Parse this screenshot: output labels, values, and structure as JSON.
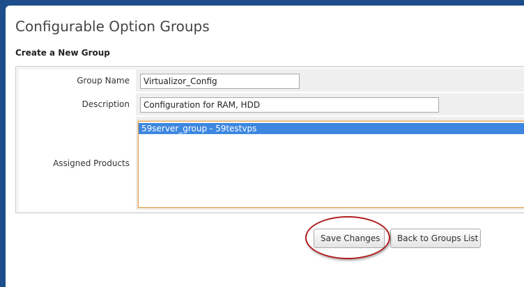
{
  "page": {
    "title": "Configurable Option Groups",
    "section_title": "Create a New Group"
  },
  "form": {
    "group_name": {
      "label": "Group Name",
      "value": "Virtualizor_Config"
    },
    "description": {
      "label": "Description",
      "value": "Configuration for RAM, HDD"
    },
    "assigned_products": {
      "label": "Assigned Products",
      "options": [
        "59server_group - 59testvps"
      ],
      "selected": "59server_group - 59testvps"
    }
  },
  "buttons": {
    "save_label": "Save Changes",
    "back_label": "Back to Groups List"
  },
  "colors": {
    "header_bg": "#1d4d8a",
    "selection": "#3d87e0",
    "highlight_annotation": "#b01c1c",
    "focus_border": "#e0a050"
  }
}
